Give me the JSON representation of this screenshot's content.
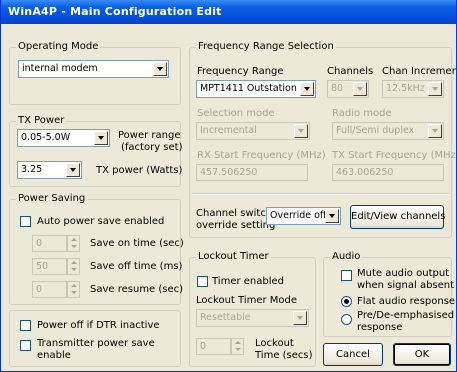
{
  "window": {
    "title": "WinA4P - Main Configuration Edit"
  },
  "operating_mode": {
    "legend": "Operating Mode",
    "value": "internal modem"
  },
  "tx_power": {
    "legend": "TX Power",
    "range_value": "0.05-5.0W",
    "range_label_1": "Power range",
    "range_label_2": "(factory set)",
    "power_value": "3.25",
    "power_label": "TX power (Watts)"
  },
  "power_saving": {
    "legend": "Power Saving",
    "auto_label": "Auto power save enabled",
    "on_time_value": "0",
    "on_time_label": "Save on time (sec)",
    "off_time_value": "50",
    "off_time_label": "Save off time (ms)",
    "resume_value": "0",
    "resume_label": "Save resume (sec)"
  },
  "power_off": {
    "label": "Power off if DTR inactive"
  },
  "transmitter_save": {
    "label_1": "Transmitter power save",
    "label_2": "enable"
  },
  "frequency": {
    "legend": "Frequency Range Selection",
    "range_label": "Frequency Range",
    "range_value": "MPT1411 Outstation",
    "channels_label": "Channels",
    "channels_value": "80",
    "increment_label": "Chan Increment",
    "increment_value": "12.5kHz",
    "selection_label": "Selection mode",
    "selection_value": "Incremental",
    "radio_label": "Radio mode",
    "radio_value": "Full/Semi duplex",
    "rx_label": "RX Start Frequency (MHz)",
    "rx_value": "457.506250",
    "tx_label": "TX Start Frequency (MHz)",
    "tx_value": "463.006250",
    "switch_label_1": "Channel switch",
    "switch_label_2": "override setting",
    "switch_value": "Override off",
    "edit_button": "Edit/View channels"
  },
  "lockout": {
    "legend": "Lockout Timer",
    "enabled_label": "Timer enabled",
    "mode_label": "Lockout Timer Mode",
    "mode_value": "Resettable",
    "time_value": "0",
    "time_label_1": "Lockout",
    "time_label_2": "Time (secs)"
  },
  "audio": {
    "legend": "Audio",
    "mute_label_1": "Mute audio output",
    "mute_label_2": "when signal absent",
    "flat_label": "Flat audio response",
    "pre_label_1": "Pre/De-emphasised",
    "pre_label_2": "response"
  },
  "buttons": {
    "cancel": "Cancel",
    "ok": "OK"
  }
}
